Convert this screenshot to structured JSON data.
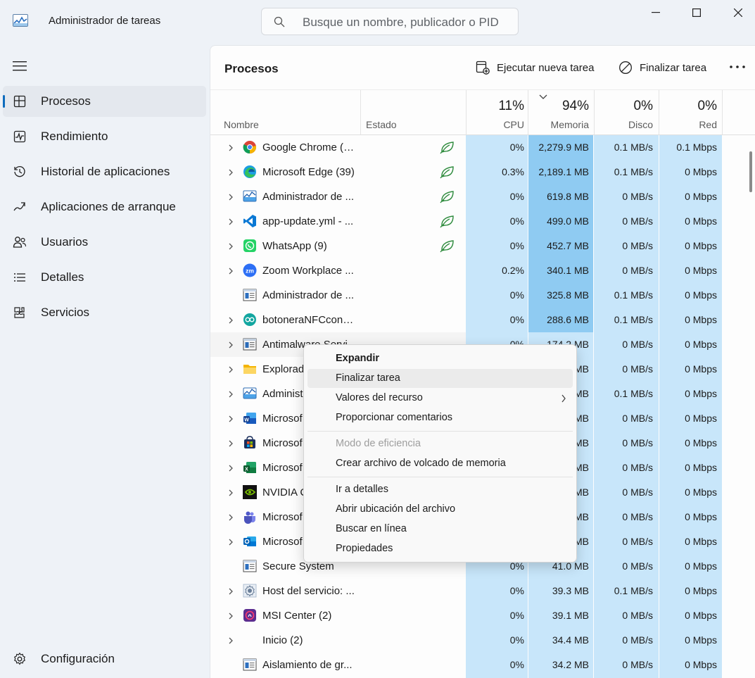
{
  "window": {
    "title": "Administrador de tareas",
    "search_placeholder": "Busque un nombre, publicador o PID"
  },
  "sidebar": {
    "items": [
      {
        "label": "Procesos",
        "icon": "processes-icon",
        "active": true
      },
      {
        "label": "Rendimiento",
        "icon": "performance-icon"
      },
      {
        "label": "Historial de aplicaciones",
        "icon": "history-icon"
      },
      {
        "label": "Aplicaciones de arranque",
        "icon": "startup-icon"
      },
      {
        "label": "Usuarios",
        "icon": "users-icon"
      },
      {
        "label": "Detalles",
        "icon": "details-icon"
      },
      {
        "label": "Servicios",
        "icon": "services-icon"
      }
    ],
    "settings_label": "Configuración"
  },
  "toolbar": {
    "page_title": "Procesos",
    "run_task": "Ejecutar nueva tarea",
    "end_task": "Finalizar tarea"
  },
  "columns": {
    "name": "Nombre",
    "status": "Estado",
    "cpu": {
      "label": "CPU",
      "pct": "11%"
    },
    "memory": {
      "label": "Memoria",
      "pct": "94%"
    },
    "disk": {
      "label": "Disco",
      "pct": "0%"
    },
    "network": {
      "label": "Red",
      "pct": "0%"
    }
  },
  "rows": [
    {
      "name": "Google Chrome (4...",
      "icon": "chrome",
      "expand": true,
      "eco": true,
      "cpu": "0%",
      "mem": "2,279.9 MB",
      "disk": "0.1 MB/s",
      "net": "0.1 Mbps"
    },
    {
      "name": "Microsoft Edge (39)",
      "icon": "edge",
      "expand": true,
      "eco": true,
      "cpu": "0.3%",
      "mem": "2,189.1 MB",
      "disk": "0.1 MB/s",
      "net": "0 Mbps"
    },
    {
      "name": "Administrador de ...",
      "icon": "admin",
      "expand": true,
      "eco": true,
      "cpu": "0%",
      "mem": "619.8 MB",
      "disk": "0 MB/s",
      "net": "0 Mbps"
    },
    {
      "name": "app-update.yml - ...",
      "icon": "vscode",
      "expand": true,
      "eco": true,
      "cpu": "0%",
      "mem": "499.0 MB",
      "disk": "0 MB/s",
      "net": "0 Mbps"
    },
    {
      "name": "WhatsApp (9)",
      "icon": "whatsapp",
      "expand": true,
      "eco": true,
      "cpu": "0%",
      "mem": "452.7 MB",
      "disk": "0 MB/s",
      "net": "0 Mbps"
    },
    {
      "name": "Zoom Workplace ...",
      "icon": "zoom",
      "expand": true,
      "cpu": "0.2%",
      "mem": "340.1 MB",
      "disk": "0 MB/s",
      "net": "0 Mbps"
    },
    {
      "name": "Administrador de ...",
      "icon": "window",
      "expand": false,
      "cpu": "0%",
      "mem": "325.8 MB",
      "disk": "0.1 MB/s",
      "net": "0 Mbps"
    },
    {
      "name": "botoneraNFCconR...",
      "icon": "arduino",
      "expand": true,
      "cpu": "0%",
      "mem": "288.6 MB",
      "disk": "0.1 MB/s",
      "net": "0 Mbps"
    },
    {
      "name": "Antimalware Servi...",
      "icon": "window",
      "expand": true,
      "highlight": true,
      "cpu": "0%",
      "mem": "174.2 MB",
      "disk": "0 MB/s",
      "net": "0 Mbps"
    },
    {
      "name": "Explorador",
      "icon": "folder",
      "expand": true,
      "cpu": "",
      "mem": "MB",
      "disk": "0 MB/s",
      "net": "0 Mbps"
    },
    {
      "name": "Administ",
      "icon": "admin",
      "expand": true,
      "cpu": "",
      "mem": "MB",
      "disk": "0.1 MB/s",
      "net": "0 Mbps"
    },
    {
      "name": "Microsof",
      "icon": "word",
      "expand": true,
      "cpu": "",
      "mem": "MB",
      "disk": "0 MB/s",
      "net": "0 Mbps"
    },
    {
      "name": "Microsof",
      "icon": "store",
      "expand": true,
      "cpu": "",
      "mem": "MB",
      "disk": "0 MB/s",
      "net": "0 Mbps"
    },
    {
      "name": "Microsof",
      "icon": "excel",
      "expand": true,
      "cpu": "",
      "mem": "MB",
      "disk": "0 MB/s",
      "net": "0 Mbps"
    },
    {
      "name": "NVIDIA C",
      "icon": "nvidia",
      "expand": true,
      "cpu": "",
      "mem": "MB",
      "disk": "0 MB/s",
      "net": "0 Mbps"
    },
    {
      "name": "Microsof",
      "icon": "teams",
      "expand": true,
      "cpu": "",
      "mem": "MB",
      "disk": "0 MB/s",
      "net": "0 Mbps"
    },
    {
      "name": "Microsof",
      "icon": "outlook",
      "expand": true,
      "cpu": "",
      "mem": "MB",
      "disk": "0 MB/s",
      "net": "0 Mbps"
    },
    {
      "name": "Secure System",
      "icon": "window",
      "expand": false,
      "cpu": "0%",
      "mem": "41.0 MB",
      "disk": "0 MB/s",
      "net": "0 Mbps"
    },
    {
      "name": "Host del servicio: ...",
      "icon": "gear",
      "expand": true,
      "cpu": "0%",
      "mem": "39.3 MB",
      "disk": "0.1 MB/s",
      "net": "0 Mbps"
    },
    {
      "name": "MSI Center (2)",
      "icon": "msi",
      "expand": true,
      "cpu": "0%",
      "mem": "39.1 MB",
      "disk": "0 MB/s",
      "net": "0 Mbps"
    },
    {
      "name": "Inicio (2)",
      "icon": "none",
      "expand": true,
      "cpu": "0%",
      "mem": "34.4 MB",
      "disk": "0 MB/s",
      "net": "0 Mbps"
    },
    {
      "name": "Aislamiento de gr...",
      "icon": "window",
      "expand": false,
      "cpu": "0%",
      "mem": "34.2 MB",
      "disk": "0 MB/s",
      "net": "0 Mbps"
    }
  ],
  "context_menu": {
    "items": [
      {
        "label": "Expandir",
        "bold": true
      },
      {
        "label": "Finalizar tarea",
        "hover": true
      },
      {
        "label": "Valores del recurso",
        "submenu": true
      },
      {
        "label": "Proporcionar comentarios"
      },
      {
        "separator": true
      },
      {
        "label": "Modo de eficiencia",
        "disabled": true
      },
      {
        "label": "Crear archivo de volcado de memoria"
      },
      {
        "separator": true
      },
      {
        "label": "Ir a detalles"
      },
      {
        "label": "Abrir ubicación del archivo"
      },
      {
        "label": "Buscar en línea"
      },
      {
        "label": "Propiedades"
      }
    ]
  },
  "colors": {
    "accent": "#0f6cbd",
    "mem_dark": "#8fcbf2",
    "col_light": "#c8e6fa",
    "eco_green": "#2e8b3d"
  }
}
